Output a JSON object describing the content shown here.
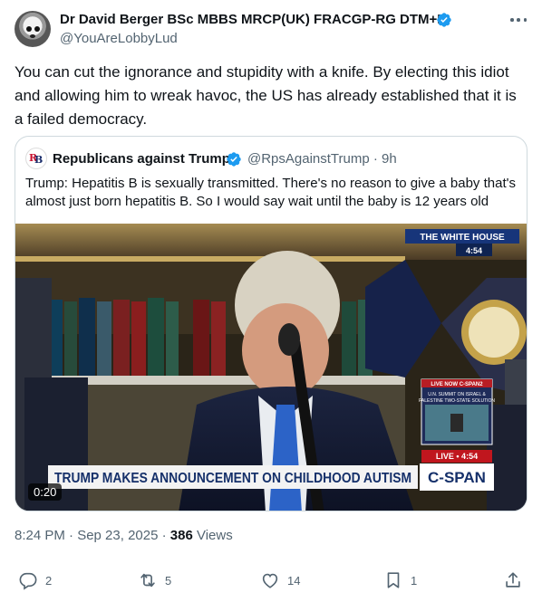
{
  "author": {
    "name": "Dr David Berger BSc MBBS MRCP(UK) FRACGP-RG DTM+H",
    "handle": "@YouAreLobbyLud",
    "verified_icon": "verified-badge-icon"
  },
  "tweet": {
    "text": "You can cut the ignorance and stupidity with a knife. By electing this idiot and allowing him to wreak havoc, the US has already established that it is a failed democracy."
  },
  "quote": {
    "name": "Republicans against Trump",
    "handle_time": "@RpsAgainstTrump · 9h",
    "text": "Trump: Hepatitis B is sexually transmitted. There's no reason to give a baby that's almost just born hepatitis B. So I would say wait until the baby is 12 years old",
    "media": {
      "duration": "0:20",
      "bug_title": "THE WHITE HOUSE",
      "bug_time": "4:54",
      "inset_top": "LIVE NOW C-SPAN2",
      "inset_line1": "U.N. SUMMIT ON ISRAEL &",
      "inset_line2": "PALESTINE TWO-STATE SOLUTION",
      "live_label": "LIVE • 4:54",
      "chyron": "TRUMP MAKES ANNOUNCEMENT ON CHILDHOOD AUTISM",
      "network": "C-SPAN"
    }
  },
  "meta": {
    "timestamp": "8:24 PM · Sep 23, 2025 · ",
    "views_count": "386",
    "views_label": " Views"
  },
  "actions": {
    "replies": "2",
    "reposts": "5",
    "likes": "14",
    "bookmarks": "1"
  },
  "colors": {
    "verified_blue": "#1d9bf0",
    "text_secondary": "#536471",
    "border": "#cfd9de"
  }
}
